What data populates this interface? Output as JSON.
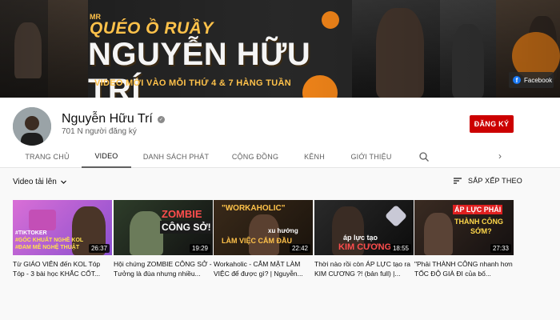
{
  "banner": {
    "mr": "MR",
    "quéo": "QUÉO Ồ RUẦY",
    "name": "NGUYỄN HỮU TRÍ",
    "tagline": "VIDEO MỚI VÀO MỖI THỨ 4 & 7 HÀNG TUẦN",
    "facebook_link": "Facebook",
    "accent_color": "#ffc24a",
    "sun_color": "#ff8c1a"
  },
  "channel": {
    "name": "Nguyễn Hữu Trí",
    "subscribers": "701 N người đăng ký",
    "subscribe_label": "ĐĂNG KÝ",
    "subscribe_color": "#cc0000"
  },
  "tabs": [
    {
      "label": "TRANG CHỦ",
      "active": false
    },
    {
      "label": "VIDEO",
      "active": true
    },
    {
      "label": "DANH SÁCH PHÁT",
      "active": false
    },
    {
      "label": "CỘNG ĐỒNG",
      "active": false
    },
    {
      "label": "KÊNH",
      "active": false
    },
    {
      "label": "GIỚI THIỆU",
      "active": false
    }
  ],
  "toolbar": {
    "uploads_label": "Video tải lên",
    "sort_label": "SẮP XẾP THEO"
  },
  "videos": [
    {
      "title": "Từ GIÁO VIÊN đến KOL Tóp Tóp - 3 bài học KHẮC CỐT...",
      "duration": "26:37",
      "thumb_texts": [
        "#TIKTOKER",
        "#GÓC KHUẤT NGHỀ KOL",
        "#ĐAM MÊ NGHỆ THUẬT"
      ]
    },
    {
      "title": "Hội chứng ZOMBIE CÔNG SỞ - Tưởng là đùa nhưng nhiều...",
      "duration": "19:29",
      "thumb_texts": [
        "ZOMBIE",
        "CÔNG SỞ!"
      ]
    },
    {
      "title": "Workaholic - CẮM MẶT LÀM VIỆC để được gì? | Nguyễn...",
      "duration": "22:42",
      "thumb_texts": [
        "\"WORKAHOLIC\"",
        "xu hướng",
        "LÀM VIỆC CẮM ĐẦU"
      ]
    },
    {
      "title": "Thời nào rồi còn ÁP LỰC tạo ra KIM CƯƠNG ?! (bản full) |...",
      "duration": "18:55",
      "thumb_texts": [
        "áp lực tạo",
        "KIM CƯƠNG"
      ]
    },
    {
      "title": "\"Phải THÀNH CÔNG nhanh hơn TỐC ĐỘ GIÀ ĐI của bố...",
      "duration": "27:33",
      "thumb_texts": [
        "ÁP LỰC PHẢI",
        "THÀNH CÔNG",
        "SỚM?"
      ]
    }
  ]
}
